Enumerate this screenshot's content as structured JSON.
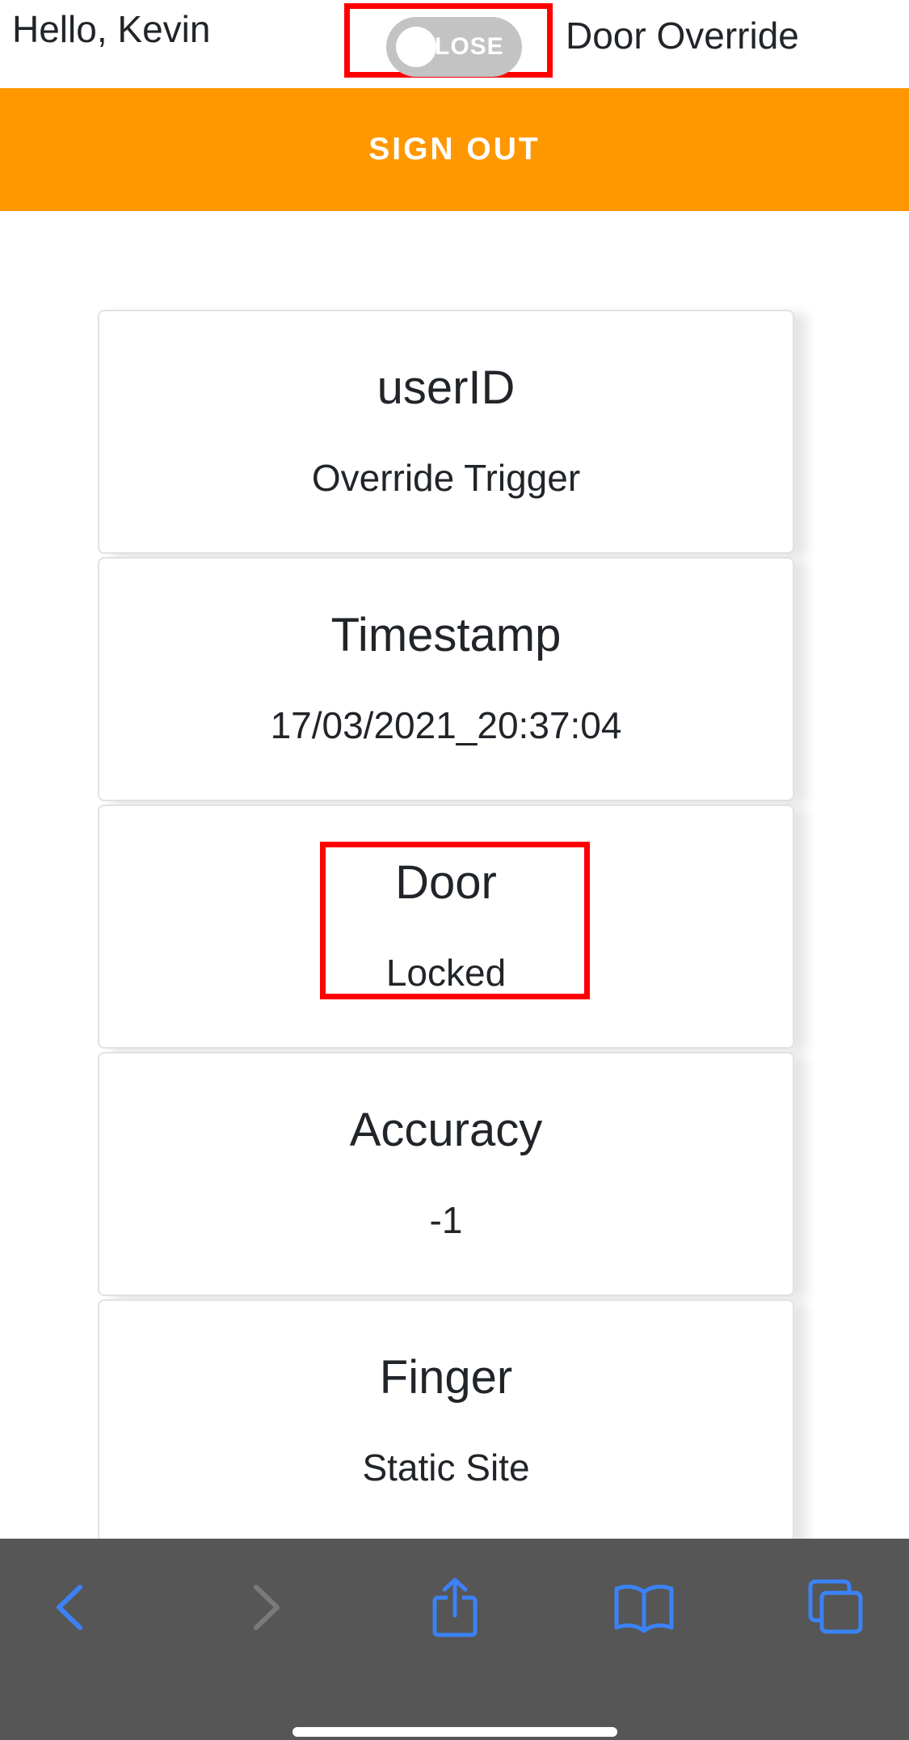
{
  "header": {
    "greeting": "Hello, Kevin",
    "toggle_label": "LOSE",
    "override_label": "Door Override"
  },
  "signout": {
    "label": "SIGN OUT"
  },
  "cards": [
    {
      "title": "userID",
      "value": "Override Trigger"
    },
    {
      "title": "Timestamp",
      "value": "17/03/2021_20:37:04"
    },
    {
      "title": "Door",
      "value": "Locked"
    },
    {
      "title": "Accuracy",
      "value": "-1"
    },
    {
      "title": "Finger",
      "value": "Static Site"
    }
  ],
  "toolbar": {
    "icons": [
      "back-icon",
      "forward-icon",
      "share-icon",
      "bookmarks-icon",
      "tabs-icon"
    ]
  },
  "colors": {
    "accent": "#ff9800",
    "highlight": "#ff0000",
    "toolbar_bg": "#565656",
    "toolbar_icon": "#3b82f6",
    "toolbar_icon_disabled": "#7a7a7a",
    "toggle_bg": "#c3c3c3"
  }
}
